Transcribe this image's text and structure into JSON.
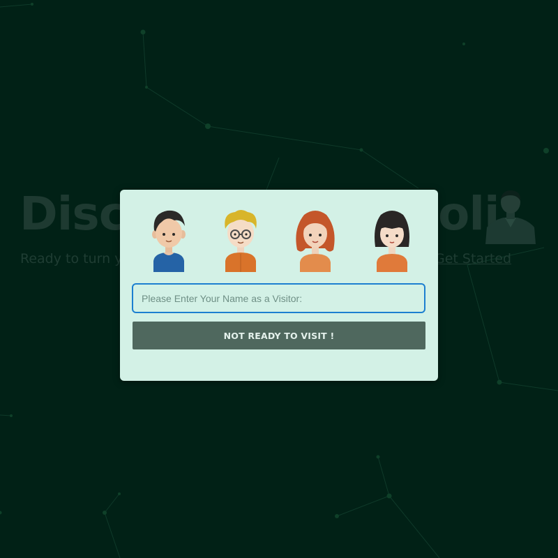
{
  "background": {
    "hero_title_left": "Disc",
    "hero_title_right": "oli",
    "hero_subtitle": "Ready to turn yo",
    "get_started_link": "Get Started"
  },
  "modal": {
    "avatars": [
      {
        "name": "boy-avatar",
        "shirt_color": "#2563a6",
        "hair_color": "#2b2a28"
      },
      {
        "name": "boy-glasses-avatar",
        "shirt_color": "#d9732a",
        "hair_color": "#d8b52a"
      },
      {
        "name": "girl-redhair-avatar",
        "shirt_color": "#e38c4c",
        "hair_color": "#c4562a"
      },
      {
        "name": "girl-bob-avatar",
        "shirt_color": "#e07a3a",
        "hair_color": "#2a2625"
      }
    ],
    "name_input": {
      "placeholder": "Please Enter Your Name as a Visitor:",
      "value": ""
    },
    "not_ready_button": "NOT READY TO VISIT !"
  },
  "colors": {
    "page_background": "#012116",
    "modal_background": "#d3f1e6",
    "input_border": "#1c7fd0",
    "button_background": "#4f685e"
  }
}
